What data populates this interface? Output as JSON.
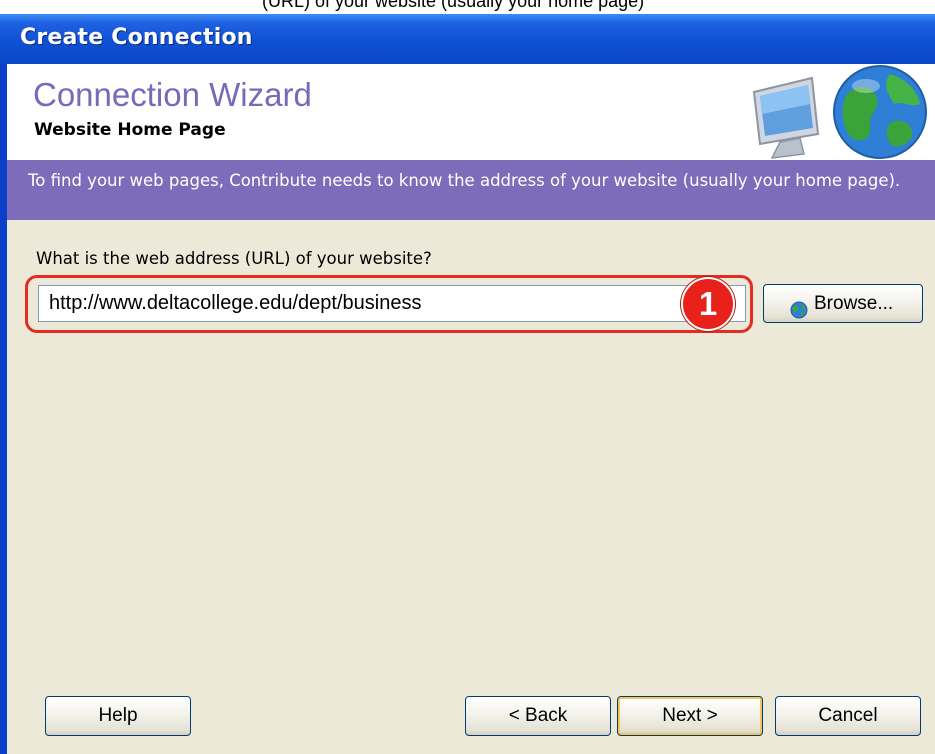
{
  "top_strip_text": "(URL) of your website (usually your home page)",
  "window": {
    "title": "Create Connection"
  },
  "wizard": {
    "title": "Connection Wizard",
    "subtitle": "Website Home Page",
    "description": "To find your web pages, Contribute needs to know the address of your website (usually your home page)."
  },
  "form": {
    "question": "What is the web address (URL) of your website?",
    "url_value": "http://www.deltacollege.edu/dept/business",
    "callout_number": "1",
    "browse_label": "Browse..."
  },
  "buttons": {
    "help": "Help",
    "back": "< Back",
    "next": "Next >",
    "cancel": "Cancel"
  },
  "icons": {
    "header_art": "monitor-globe-icon",
    "browse": "globe-icon"
  },
  "colors": {
    "title_bar": "#0f51d6",
    "banner": "#7c6cba",
    "wizard_title": "#7a68b8",
    "client_bg": "#ece9d8",
    "highlight": "#e32d24"
  }
}
